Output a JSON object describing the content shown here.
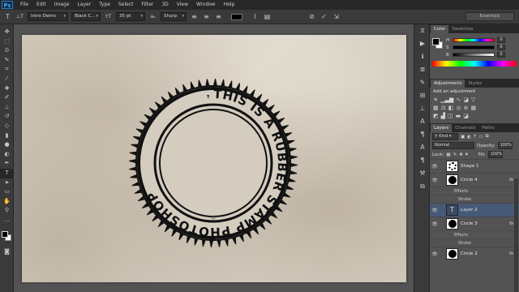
{
  "app": {
    "logo": "Ps"
  },
  "menu": [
    "File",
    "Edit",
    "Image",
    "Layer",
    "Type",
    "Select",
    "Filter",
    "3D",
    "View",
    "Window",
    "Help"
  ],
  "options": {
    "font_family": "Intro Demo",
    "font_style": "Black C...",
    "font_size": "35 pt",
    "aa_label": "aₐ",
    "antialias": "Sharp",
    "workspace": "Essentials"
  },
  "stamp": {
    "text": "THIS IS A RUBBER STAMP PHOTOSHOP",
    "ink_color": "#111111"
  },
  "color_panel": {
    "tabs": [
      "Color",
      "Swatches"
    ],
    "rows": [
      {
        "label": "H",
        "value": "0"
      },
      {
        "label": "S",
        "value": "0"
      },
      {
        "label": "B",
        "value": "0"
      }
    ]
  },
  "adjustments": {
    "tabs": [
      "Adjustments",
      "Styles"
    ],
    "title": "Add an adjustment"
  },
  "layers_panel": {
    "tabs": [
      "Layers",
      "Channels",
      "Paths"
    ],
    "filter": "Kind",
    "blend_mode": "Normal",
    "opacity_label": "Opacity:",
    "opacity": "100%",
    "lock_label": "Lock:",
    "fill_label": "Fill:",
    "fill": "100%",
    "layers": [
      {
        "name": "Shape 1",
        "fx": false,
        "selected": false,
        "thumb": "shape"
      },
      {
        "name": "Circle 4",
        "fx": true,
        "selected": false,
        "thumb": "circle",
        "effects_label": "Effects",
        "stroke_label": "Stroke"
      },
      {
        "name": "Layer 2",
        "fx": false,
        "selected": true,
        "thumb": "text"
      },
      {
        "name": "Circle 3",
        "fx": true,
        "selected": false,
        "thumb": "circle",
        "effects_label": "Effects",
        "stroke_label": "Stroke"
      },
      {
        "name": "Circle 2",
        "fx": true,
        "selected": false,
        "thumb": "circle"
      }
    ]
  }
}
